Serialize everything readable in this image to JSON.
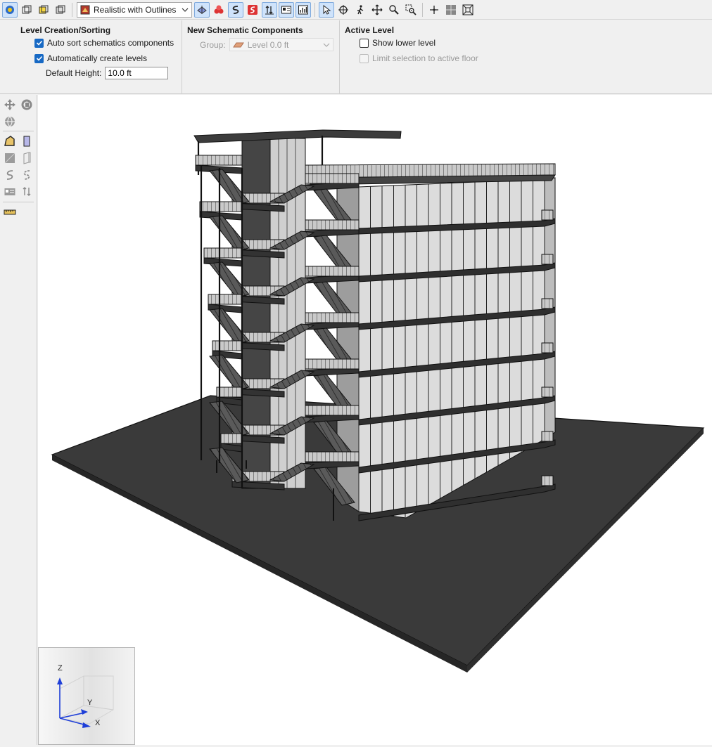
{
  "toolbar": {
    "render_mode": "Realistic with Outlines",
    "icons": [
      "camera-icon",
      "view-cube-icon",
      "view-cube-yellow-icon",
      "view-cube-outline-icon",
      "render-style-icon",
      "schematic-plane-icon",
      "stack-icon",
      "flow-path-icon",
      "red-path-icon",
      "level-sort-icon",
      "card-icon",
      "chart-icon",
      "select-arrow-icon",
      "orbit-icon",
      "walk-icon",
      "pan-icon",
      "zoom-icon",
      "zoom-box-icon",
      "axis-icon",
      "grid-icon",
      "fit-view-icon"
    ]
  },
  "options": {
    "level_creation": {
      "title": "Level Creation/Sorting",
      "auto_sort_label": "Auto sort schematics components",
      "auto_sort_checked": true,
      "auto_create_label": "Automatically create levels",
      "auto_create_checked": true,
      "default_height_label": "Default Height:",
      "default_height_value": "10.0 ft"
    },
    "new_schematic": {
      "title": "New Schematic Components",
      "group_label": "Group:",
      "group_value": "Level 0.0 ft"
    },
    "active_level": {
      "title": "Active Level",
      "show_lower_label": "Show lower level",
      "show_lower_checked": false,
      "limit_selection_label": "Limit selection to active floor",
      "limit_selection_checked": false
    }
  },
  "navcube": {
    "axis_z": "Z",
    "axis_y": "Y",
    "axis_x": "X"
  },
  "colors": {
    "accent": "#1769c4",
    "ground": "#3a3a3a",
    "glass": "#d8d8d8"
  }
}
